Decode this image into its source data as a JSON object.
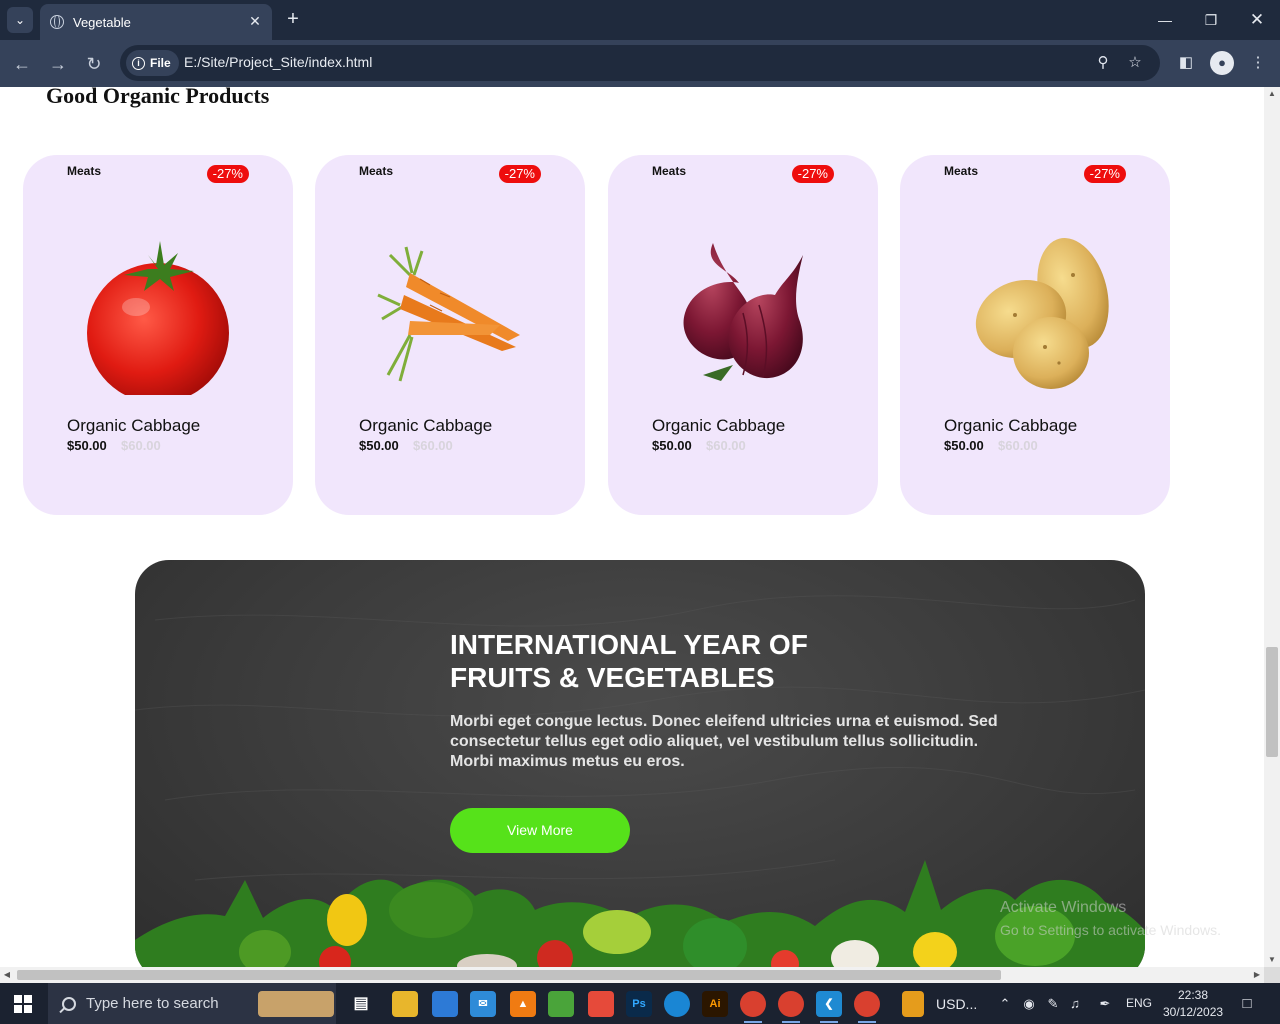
{
  "browser": {
    "tab_title": "Vegetable",
    "file_chip": "File",
    "url": "E:/Site/Project_Site/index.html"
  },
  "page": {
    "section_title": "Good Organic Products",
    "products": [
      {
        "category": "Meats",
        "discount": "-27%",
        "name": "Organic Cabbage",
        "price": "$50.00",
        "old_price": "$60.00",
        "image": "tomato"
      },
      {
        "category": "Meats",
        "discount": "-27%",
        "name": "Organic Cabbage",
        "price": "$50.00",
        "old_price": "$60.00",
        "image": "carrots"
      },
      {
        "category": "Meats",
        "discount": "-27%",
        "name": "Organic Cabbage",
        "price": "$50.00",
        "old_price": "$60.00",
        "image": "red-onions"
      },
      {
        "category": "Meats",
        "discount": "-27%",
        "name": "Organic Cabbage",
        "price": "$50.00",
        "old_price": "$60.00",
        "image": "potatoes"
      }
    ],
    "banner": {
      "title_line1": "INTERNATIONAL YEAR OF",
      "title_line2": "FRUITS & VEGETABLES",
      "text": "Morbi eget congue lectus. Donec eleifend ultricies urna et euismod. Sed consectetur tellus eget odio aliquet, vel vestibulum tellus sollicitudin. Morbi maximus metus eu eros.",
      "button": "View More"
    },
    "watermark": {
      "line1": "Activate Windows",
      "line2": "Go to Settings to activate Windows."
    }
  },
  "taskbar": {
    "search_placeholder": "Type here to search",
    "usd_label": "USD...",
    "language": "ENG",
    "time": "22:38",
    "date": "30/12/2023"
  },
  "colors": {
    "card_bg": "#f1e6fc",
    "badge": "#ee0d0d",
    "button_green": "#56e21a",
    "chrome_dark": "#1f2a3d",
    "chrome_toolbar": "#35425a"
  }
}
